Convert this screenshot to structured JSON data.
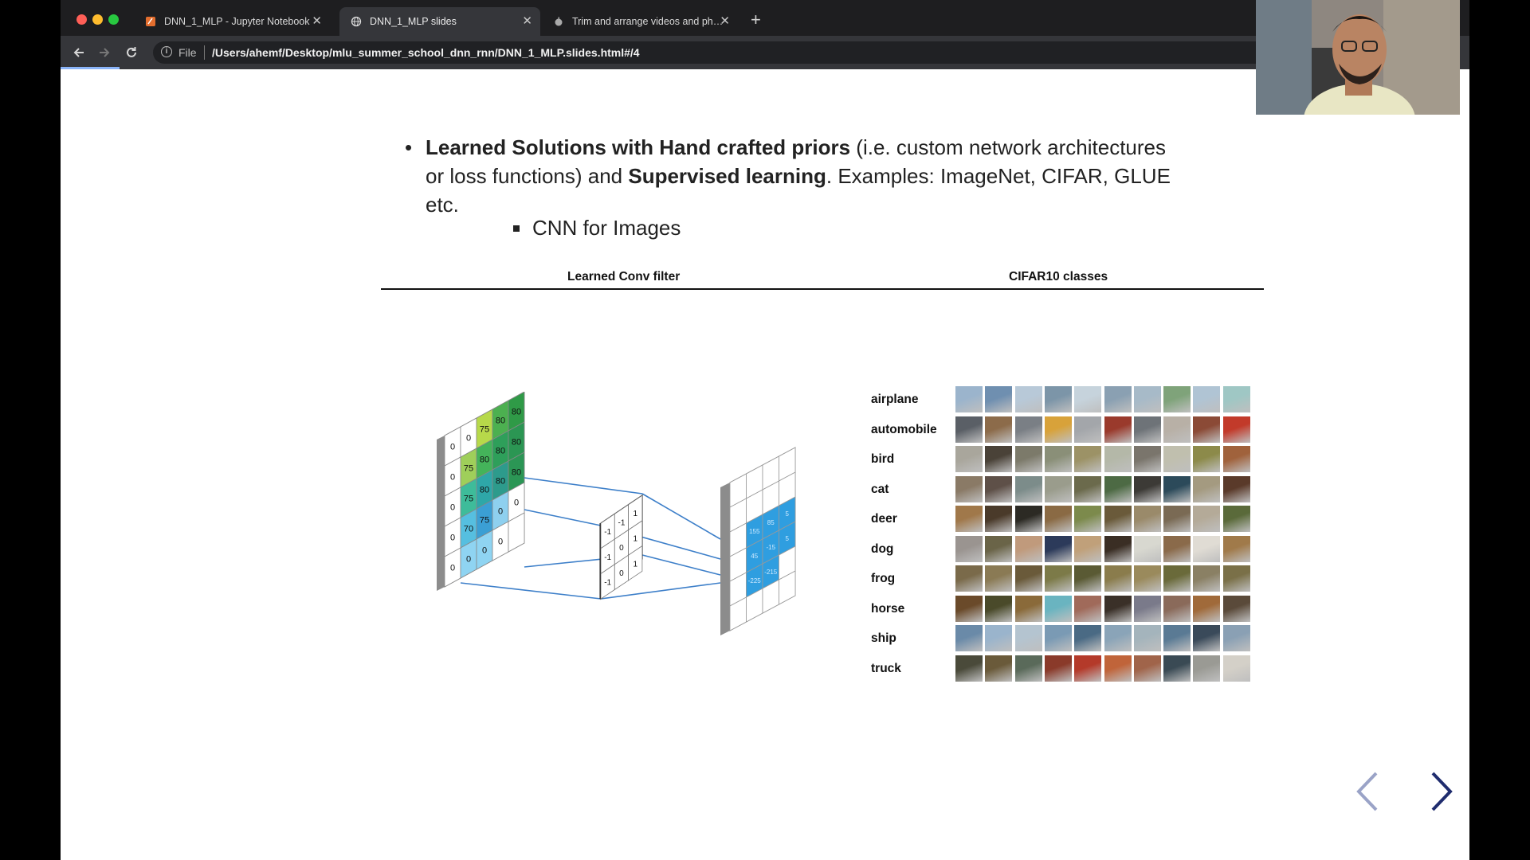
{
  "browser": {
    "tabs": [
      {
        "title": "DNN_1_MLP - Jupyter Notebook",
        "icon": "jupyter-icon",
        "close": "✕",
        "active": false
      },
      {
        "title": "DNN_1_MLP slides",
        "icon": "globe-icon",
        "close": "✕",
        "active": true
      },
      {
        "title": "Trim and arrange videos and photos",
        "icon": "apple-icon",
        "close": "✕",
        "active": false
      }
    ],
    "new_tab": "+",
    "address": {
      "scheme_label": "File",
      "url": "/Users/ahemf/Desktop/mlu_summer_school_dnn_rnn/DNN_1_MLP.slides.html#/4"
    }
  },
  "slide": {
    "bullet1": {
      "bold1": "Learned Solutions with Hand crafted priors",
      "text1": " (i.e. custom network architectures or loss functions) and ",
      "bold2": "Supervised learning",
      "text2": ". Examples: ImageNet, CIFAR, GLUE etc."
    },
    "bullet2": "CNN for Images",
    "table_headers": [
      "Learned Conv filter",
      "CIFAR10 classes"
    ],
    "conv_figure": {
      "input_columns": [
        [
          "0",
          "0",
          "0",
          "0",
          "0"
        ],
        [
          "0",
          "75",
          "75",
          "70",
          "0"
        ],
        [
          "75",
          "80",
          "80",
          "75",
          "0"
        ],
        [
          "80",
          "80",
          "80",
          "0",
          "0"
        ],
        [
          "80",
          "80",
          "80",
          "0",
          ""
        ]
      ],
      "kernel": [
        [
          "-1",
          "-1",
          "-1"
        ],
        [
          "-1",
          "0",
          "0"
        ],
        [
          "1",
          "1",
          "1"
        ]
      ],
      "output_values": [
        "155",
        "85",
        "5",
        "45",
        "-15",
        "5",
        "-225",
        "-215"
      ]
    },
    "cifar_classes": [
      "airplane",
      "automobile",
      "bird",
      "cat",
      "deer",
      "dog",
      "frog",
      "horse",
      "ship",
      "truck"
    ],
    "nav": {
      "prev": "previous-slide",
      "next": "next-slide"
    }
  },
  "colors": {
    "accent": "#8ab4f8",
    "nav_active": "#1f2c6e",
    "nav_inactive": "#9aa3c7"
  }
}
